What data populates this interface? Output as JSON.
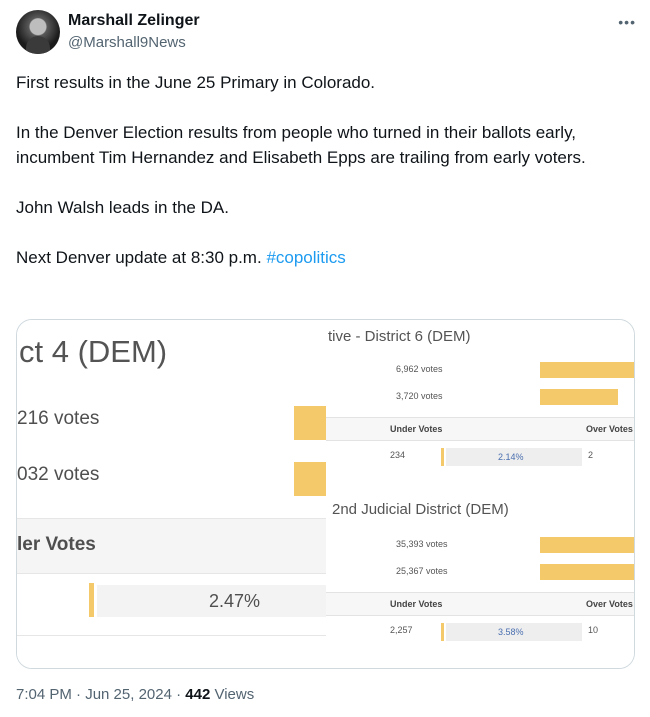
{
  "author": {
    "name": "Marshall Zelinger",
    "handle": "@Marshall9News"
  },
  "tweet": {
    "paragraphs": [
      "First results in the June 25 Primary in Colorado.",
      "In the Denver Election results from people who turned in their ballots early, incumbent Tim Hernandez and Elisabeth Epps are trailing from early voters.",
      "John Walsh leads in the DA."
    ],
    "last_line_text": "Next Denver update at 8:30 p.m.",
    "hashtag": "#copolitics"
  },
  "media": {
    "left": {
      "title": "ct 4 (DEM)",
      "votes_1": "216 votes",
      "votes_2": "032 votes",
      "under_votes_label": "ler Votes",
      "percent": "2.47%"
    },
    "right": {
      "section_1": {
        "title": "tive - District 6 (DEM)",
        "votes_1": "6,962 votes",
        "votes_2": "3,720 votes",
        "under_votes_label": "Under Votes",
        "over_votes_label": "Over Votes",
        "under_votes_value": "234",
        "percent": "2.14%",
        "over_votes_value": "2"
      },
      "section_2": {
        "title": "2nd Judicial District (DEM)",
        "votes_1": "35,393 votes",
        "votes_2": "25,367 votes",
        "under_votes_label": "Under Votes",
        "over_votes_label": "Over Votes",
        "under_votes_value": "2,257",
        "percent": "3.58%",
        "over_votes_value": "10"
      }
    }
  },
  "footer": {
    "timestamp": "7:04 PM · Jun 25, 2024 · ",
    "views_count": "442",
    "views_label": " Views"
  },
  "colors": {
    "link": "#1d9bf0",
    "bar": "#f3c96a",
    "muted": "#536471"
  }
}
